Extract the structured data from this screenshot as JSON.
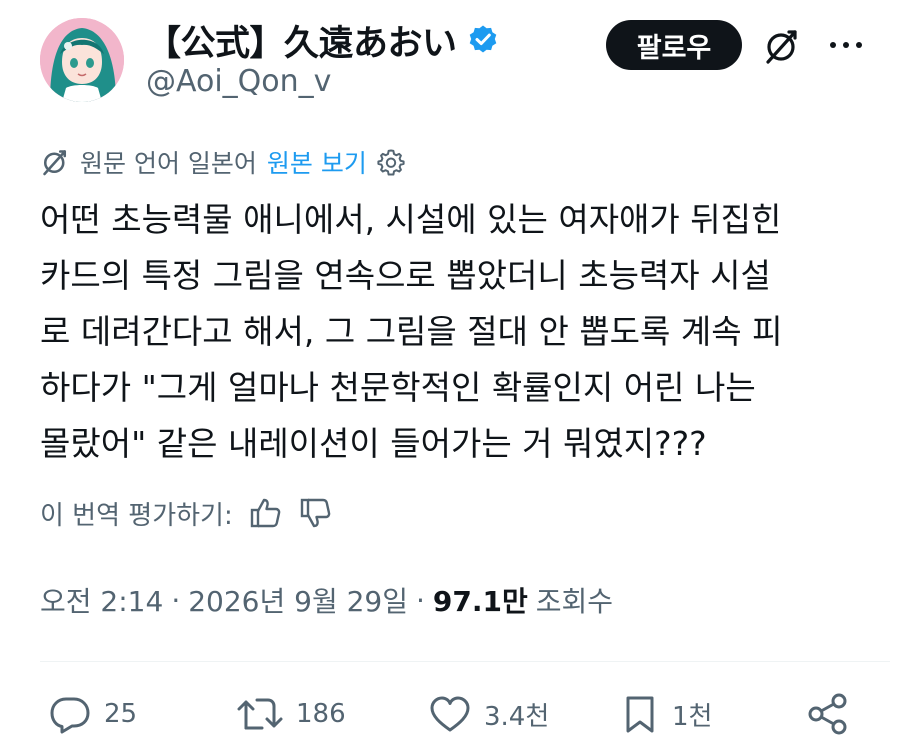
{
  "author": {
    "display_name": "【公式】久遠あおい",
    "handle": "@Aoi_Qon_v",
    "verified_icon": "verified-badge-icon",
    "avatar": "avatar-anime-character"
  },
  "header": {
    "follow_label": "팔로우",
    "translate_icon": "translate-icon",
    "more_icon": "more-icon"
  },
  "translation": {
    "source_label": "원문 언어 일본어",
    "show_original_label": "원본 보기",
    "settings_icon": "gear-icon"
  },
  "tweet": {
    "lines": [
      "어떤 초능력물 애니에서, 시설에 있는 여자애가 뒤집힌",
      "카드의 특정 그림을 연속으로 뽑았더니 초능력자 시설",
      "로 데려간다고 해서, 그 그림을 절대 안 뽑도록 계속 피",
      "하다가 \"그게 얼마나 천문학적인 확률인지 어린 나는",
      "몰랐어\" 같은 내레이션이 들어가는 거 뭐였지???"
    ]
  },
  "rating": {
    "label": "이 번역 평가하기:",
    "thumbs_up_icon": "thumbs-up-icon",
    "thumbs_down_icon": "thumbs-down-icon"
  },
  "meta": {
    "time": "오전 2:14",
    "separator": "·",
    "date": "2026년 9월 29일",
    "views_count": "97.1만",
    "views_label": "조회수"
  },
  "actions": {
    "replies": "25",
    "reposts": "186",
    "likes": "3.4천",
    "bookmarks": "1천"
  },
  "colors": {
    "accent": "#1d9bf0",
    "text": "#0f1419",
    "secondary": "#536471",
    "button": "#0f1419"
  }
}
